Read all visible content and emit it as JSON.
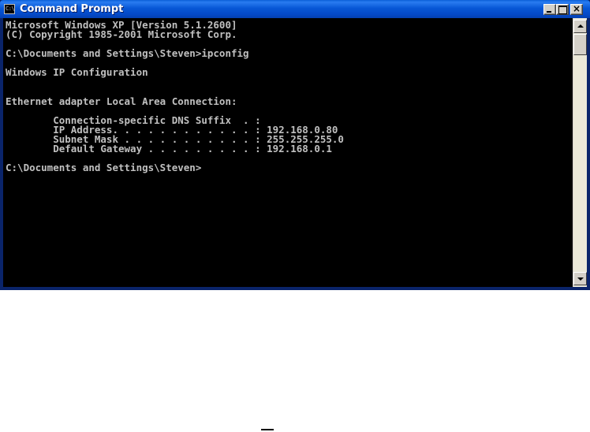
{
  "window": {
    "title": "Command Prompt",
    "icon": "cmd-icon",
    "icon_text": "C:\\",
    "buttons": {
      "minimize": "minimize-icon",
      "maximize": "maximize-icon",
      "close": "close-icon",
      "close_glyph": "×"
    }
  },
  "console": {
    "foreground": "#c0c0c0",
    "background": "#000000",
    "lines": [
      "Microsoft Windows XP [Version 5.1.2600]",
      "(C) Copyright 1985-2001 Microsoft Corp.",
      "",
      "C:\\Documents and Settings\\Steven>ipconfig",
      "",
      "Windows IP Configuration",
      "",
      "",
      "Ethernet adapter Local Area Connection:",
      "",
      "        Connection-specific DNS Suffix  . :",
      "        IP Address. . . . . . . . . . . . : 192.168.0.80",
      "        Subnet Mask . . . . . . . . . . . : 255.255.255.0",
      "        Default Gateway . . . . . . . . . : 192.168.0.1",
      "",
      "C:\\Documents and Settings\\Steven>"
    ]
  },
  "scrollbar": {
    "up_icon": "scroll-up-arrow-icon",
    "down_icon": "scroll-down-arrow-icon"
  }
}
